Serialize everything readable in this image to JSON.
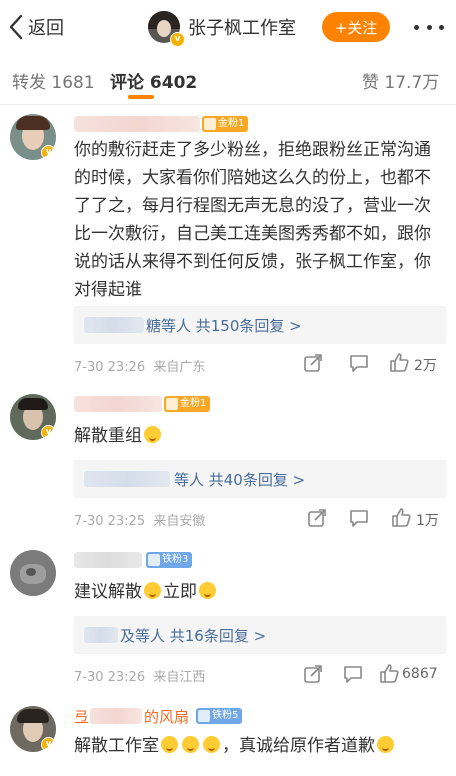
{
  "nav": {
    "back_label": "返回",
    "account_name": "张子枫工作室",
    "follow_label": "+关注"
  },
  "tabs": {
    "repost": "转发 1681",
    "comment": "评论 6402",
    "like": "赞 17.7万"
  },
  "comments": [
    {
      "user_suffix": "",
      "fan_badge": "金粉1",
      "text": "你的敷衍赶走了多少粉丝，拒绝跟粉丝正常沟通的时候，大家看你们陪她这么久的份上，也都不了了之，每月行程图无声无息的没了，营业一次比一次敷衍，自己美工连美图秀秀都不如，跟你说的话从来得不到任何反馈，张子枫工作室，你对得起谁",
      "reply_summary": "糖等人  共150条回复 >",
      "time": "7-30 23:26",
      "location": "来自广东",
      "likes": "2万"
    },
    {
      "user_suffix": "",
      "fan_badge": "金粉1",
      "text": "解散重组",
      "reply_summary": "等人  共40条回复 >",
      "time": "7-30 23:25",
      "location": "来自安徽",
      "likes": "1万"
    },
    {
      "user_suffix": "",
      "fan_badge": "铁粉3",
      "text": "建议解散",
      "text2": "立即",
      "reply_summary": "及等人  共16条回复 >",
      "time": "7-30 23:26",
      "location": "来自江西",
      "likes": "6867"
    },
    {
      "user_prefix": "弖",
      "user_suffix": "的风扇",
      "fan_badge": "铁粉5",
      "text": "解散工作室",
      "text2": "，真诚给原作者道歉"
    }
  ]
}
